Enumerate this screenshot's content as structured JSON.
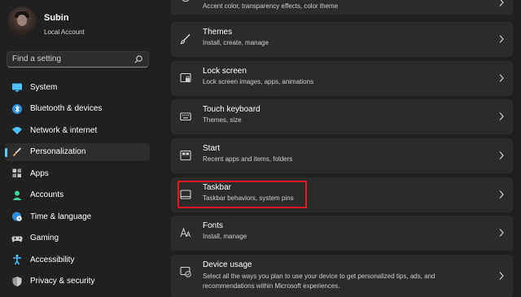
{
  "profile": {
    "name": "Subin",
    "account_type": "Local Account"
  },
  "search": {
    "placeholder": "Find a setting",
    "icon": "search-icon"
  },
  "sidebar": {
    "items": [
      {
        "label": "System",
        "icon": "system-icon",
        "color": "#4cc2ff"
      },
      {
        "label": "Bluetooth & devices",
        "icon": "bluetooth-icon",
        "color": "#4cc2ff"
      },
      {
        "label": "Network & internet",
        "icon": "wifi-icon",
        "color": "#4cc2ff"
      },
      {
        "label": "Personalization",
        "icon": "brush-icon",
        "color": "#f0a060",
        "active": true
      },
      {
        "label": "Apps",
        "icon": "apps-icon",
        "color": "#c8c8c8"
      },
      {
        "label": "Accounts",
        "icon": "accounts-icon",
        "color": "#3fd19a"
      },
      {
        "label": "Time & language",
        "icon": "globe-clock-icon",
        "color": "#4cc2ff"
      },
      {
        "label": "Gaming",
        "icon": "gamepad-icon",
        "color": "#c8c8c8"
      },
      {
        "label": "Accessibility",
        "icon": "accessibility-icon",
        "color": "#4cc2ff"
      },
      {
        "label": "Privacy & security",
        "icon": "shield-icon",
        "color": "#c8c8c8"
      }
    ]
  },
  "main": {
    "cards": [
      {
        "title": "",
        "subtitle": "Accent color, transparency effects, color theme",
        "icon": "colors-icon"
      },
      {
        "title": "Themes",
        "subtitle": "Install, create, manage",
        "icon": "brush-icon"
      },
      {
        "title": "Lock screen",
        "subtitle": "Lock screen images, apps, animations",
        "icon": "lock-screen-icon"
      },
      {
        "title": "Touch keyboard",
        "subtitle": "Themes, size",
        "icon": "keyboard-icon"
      },
      {
        "title": "Start",
        "subtitle": "Recent apps and items, folders",
        "icon": "start-icon"
      },
      {
        "title": "Taskbar",
        "subtitle": "Taskbar behaviors, system pins",
        "icon": "taskbar-icon",
        "highlighted": true
      },
      {
        "title": "Fonts",
        "subtitle": "Install, manage",
        "icon": "fonts-icon"
      },
      {
        "title": "Device usage",
        "subtitle_line1": "Select all the ways you plan to use your device to get personalized tips, ads, and",
        "subtitle_line2": "recommendations within Microsoft experiences.",
        "icon": "device-usage-icon"
      }
    ],
    "highlight_color": "#e0171b"
  }
}
